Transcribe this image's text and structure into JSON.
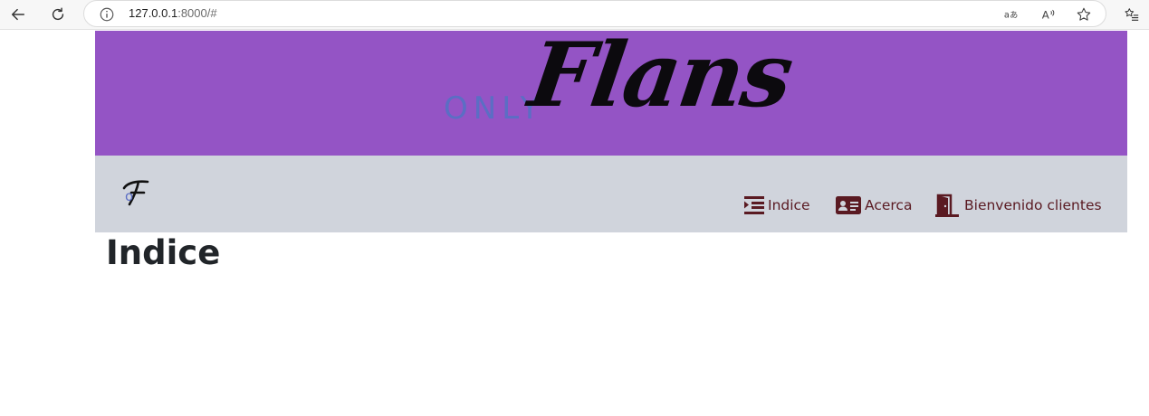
{
  "browser": {
    "url_host": "127.0.0.1",
    "url_rest": ":8000/#"
  },
  "header": {
    "logo_small": "ONLY",
    "logo_big": "Flans"
  },
  "navbar": {
    "brand_letter": "o",
    "items": [
      {
        "label": "Indice",
        "icon": "indent-list-icon"
      },
      {
        "label": "Acerca",
        "icon": "id-card-icon"
      },
      {
        "label": "Bienvenido clientes",
        "icon": "door-open-icon"
      }
    ]
  },
  "main": {
    "title": "Indice"
  },
  "colors": {
    "hero_bg": "#9454c5",
    "navbar_bg": "#d0d4dc",
    "nav_text": "#5a1a22",
    "logo_small": "#5b6ec4"
  }
}
